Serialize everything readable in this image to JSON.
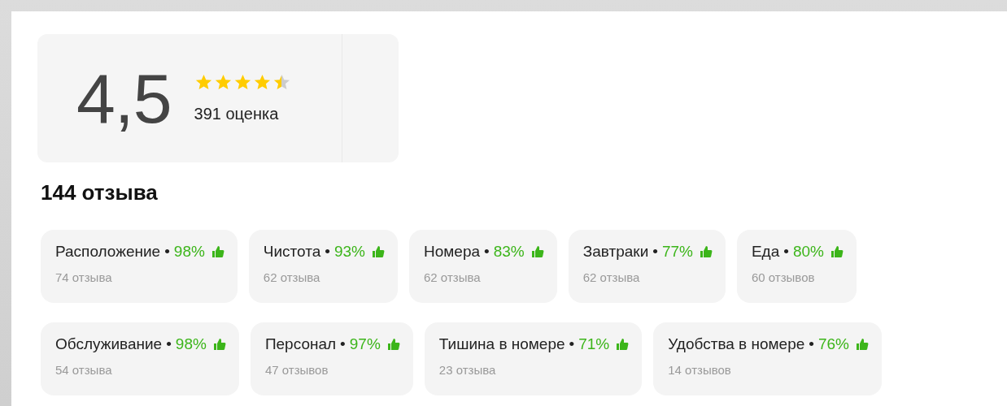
{
  "rating": {
    "score": "4,5",
    "stars": 4.5,
    "count": "391 оценка"
  },
  "reviews_title": "144 отзыва",
  "aspects": [
    {
      "label": "Расположение",
      "separator": "•",
      "percent": "98%",
      "count": "74 отзыва"
    },
    {
      "label": "Чистота",
      "separator": "•",
      "percent": "93%",
      "count": "62 отзыва"
    },
    {
      "label": "Номера",
      "separator": "•",
      "percent": "83%",
      "count": "62 отзыва"
    },
    {
      "label": "Завтраки",
      "separator": "•",
      "percent": "77%",
      "count": "62 отзыва"
    },
    {
      "label": "Еда",
      "separator": "•",
      "percent": "80%",
      "count": "60 отзывов"
    },
    {
      "label": "Обслуживание",
      "separator": "•",
      "percent": "98%",
      "count": "54 отзыва"
    },
    {
      "label": "Персонал",
      "separator": "•",
      "percent": "97%",
      "count": "47 отзывов"
    },
    {
      "label": "Тишина в номере",
      "separator": "•",
      "percent": "71%",
      "count": "23 отзыва"
    },
    {
      "label": "Удобства в номере",
      "separator": "•",
      "percent": "76%",
      "count": "14 отзывов"
    }
  ]
}
